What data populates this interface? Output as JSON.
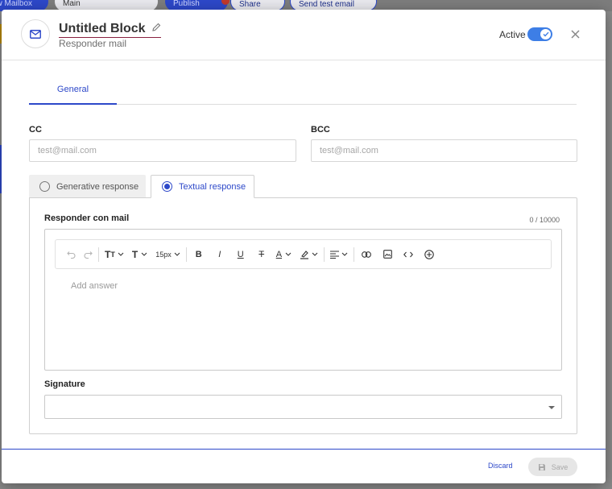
{
  "background": {
    "pill1": "ew Mailbox",
    "pill2": "Main",
    "pill3": "Publish",
    "pill4": "Share",
    "pill5": "Send test email"
  },
  "header": {
    "title": "Untitled Block",
    "subtitle": "Responder mail",
    "active_label": "Active",
    "active": true
  },
  "tabs": {
    "general": "General"
  },
  "fields": {
    "cc_label": "CC",
    "cc_placeholder": "test@mail.com",
    "bcc_label": "BCC",
    "bcc_placeholder": "test@mail.com"
  },
  "mode_tabs": {
    "generative": "Generative response",
    "textual": "Textual response",
    "selected": "textual"
  },
  "editor": {
    "label": "Responder con mail",
    "counter": "0 / 10000",
    "placeholder": "Add answer",
    "font_size": "15px"
  },
  "signature": {
    "label": "Signature",
    "value": ""
  },
  "footer": {
    "discard": "Discard",
    "save": "Save"
  },
  "colors": {
    "accent": "#2d48c9",
    "toggle": "#3d7ee6",
    "title_underline": "#8a2040"
  }
}
